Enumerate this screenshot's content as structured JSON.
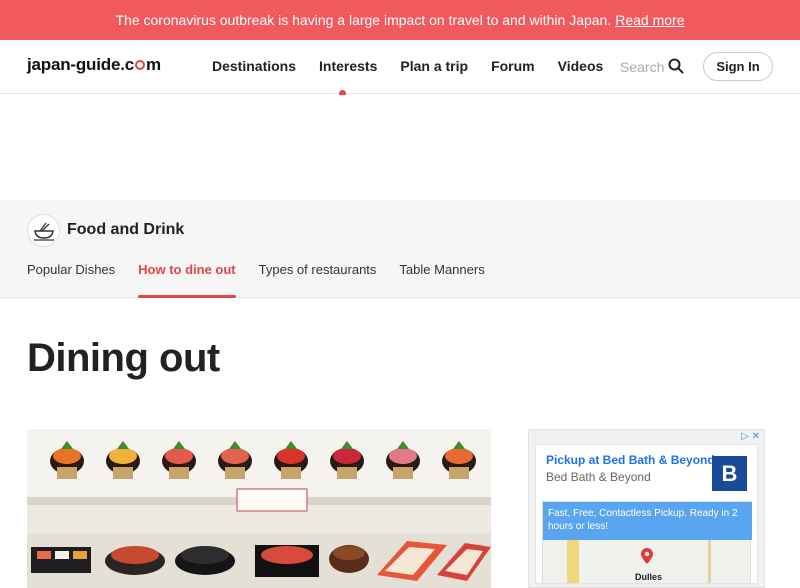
{
  "alert": {
    "text": "The coronavirus outbreak is having a large impact on travel to and within Japan.",
    "link": "Read more"
  },
  "header": {
    "logo_left": "japan-guide.c",
    "logo_right": "m",
    "nav": [
      "Destinations",
      "Interests",
      "Plan a trip",
      "Forum",
      "Videos"
    ],
    "active_nav": "Interests",
    "search_placeholder": "Search",
    "signin_label": "Sign In"
  },
  "section": {
    "title": "Food and Drink",
    "tabs": [
      "Popular Dishes",
      "How to dine out",
      "Types of restaurants",
      "Table Manners"
    ],
    "active_tab": "How to dine out"
  },
  "page": {
    "title": "Dining out"
  },
  "ad": {
    "choices": "▷ ✕",
    "headline": "Pickup at Bed Bath & Beyond",
    "advertiser": "Bed Bath & Beyond",
    "logo_letter": "B",
    "bubble": "Fast, Free, Contactless Pickup. Ready in 2 hours or less!",
    "place": "Dulles"
  },
  "colors": {
    "accent": "#e8434a",
    "alert_bg": "#f05a5f",
    "ad_blue": "#1a73e8"
  }
}
